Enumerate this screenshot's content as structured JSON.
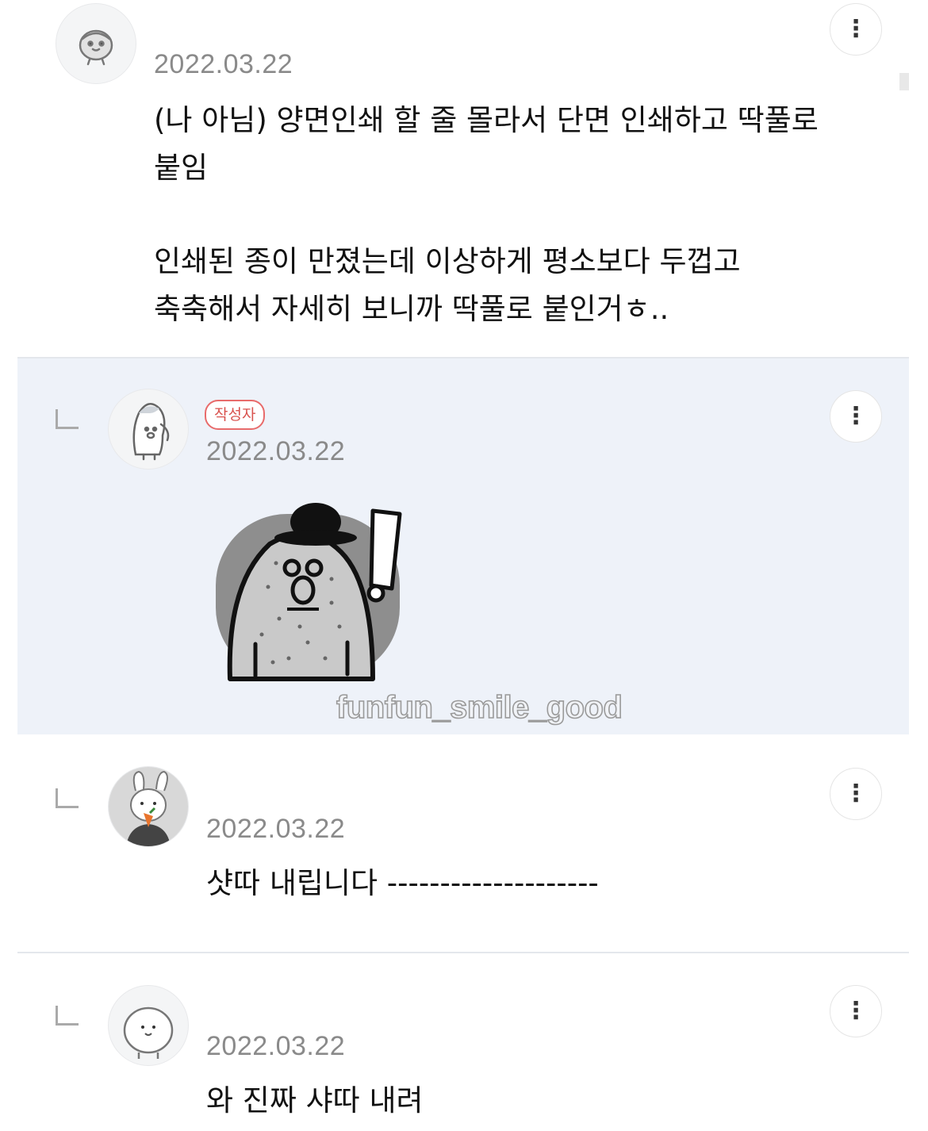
{
  "comments": [
    {
      "date": "2022.03.22",
      "lines": [
        "(나 아님) 양면인쇄 할 줄 몰라서 단면 인쇄하고 딱풀로",
        "붙임",
        "",
        "인쇄된 종이 만졌는데 이상하게 평소보다 두껍고",
        "축축해서 자세히 보니까 딱풀로 붙인거ㅎ.."
      ],
      "avatar_icon": "bird-avatar-icon"
    },
    {
      "badge": "작성자",
      "date": "2022.03.22",
      "avatar_icon": "penguin-avatar-icon",
      "sticker_icon": "mole-surprised-sticker"
    },
    {
      "date": "2022.03.22",
      "lines": [
        "샷따 내립니다 --------------------"
      ],
      "avatar_icon": "rabbit-avatar-icon"
    },
    {
      "date": "2022.03.22",
      "lines": [
        "와 진짜 샤따 내려"
      ],
      "avatar_icon": "round-face-avatar-icon"
    }
  ],
  "more_icon": "⋮",
  "reply_icon": "reply-arrow-icon",
  "watermark": "funfun_smile_good",
  "colors": {
    "reply_bg": "#eef2f9",
    "badge": "#e86b6b",
    "date": "#8a8a8a"
  }
}
